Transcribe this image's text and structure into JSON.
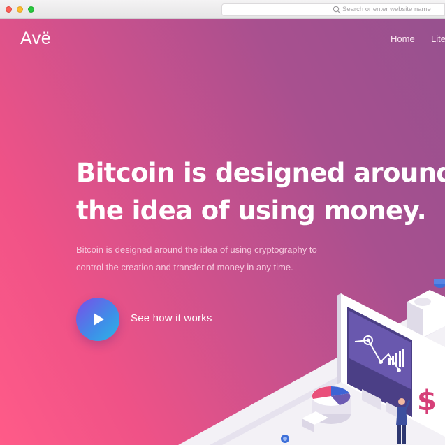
{
  "browser": {
    "url_placeholder": "Search or enter website name",
    "traffic_lights": [
      "close",
      "minimize",
      "zoom"
    ]
  },
  "header": {
    "logo": "Avë",
    "nav": [
      "Home",
      "Lite"
    ]
  },
  "hero": {
    "headline_lines": [
      "Bitcoin is designed around",
      "the idea of using money."
    ],
    "subtext_lines": [
      "Bitcoin is designed around the idea of using cryptography to",
      "control the creation and transfer of money in any time."
    ],
    "cta_label": "See how it works"
  },
  "icons": {
    "play": "play-icon",
    "search": "search-icon",
    "currency": "dollar-sign-icon"
  },
  "colors": {
    "gradient_start": "#ff5b88",
    "gradient_end": "#97518f",
    "play_gradient_start": "#7a4de8",
    "play_gradient_end": "#2bb6e6"
  }
}
